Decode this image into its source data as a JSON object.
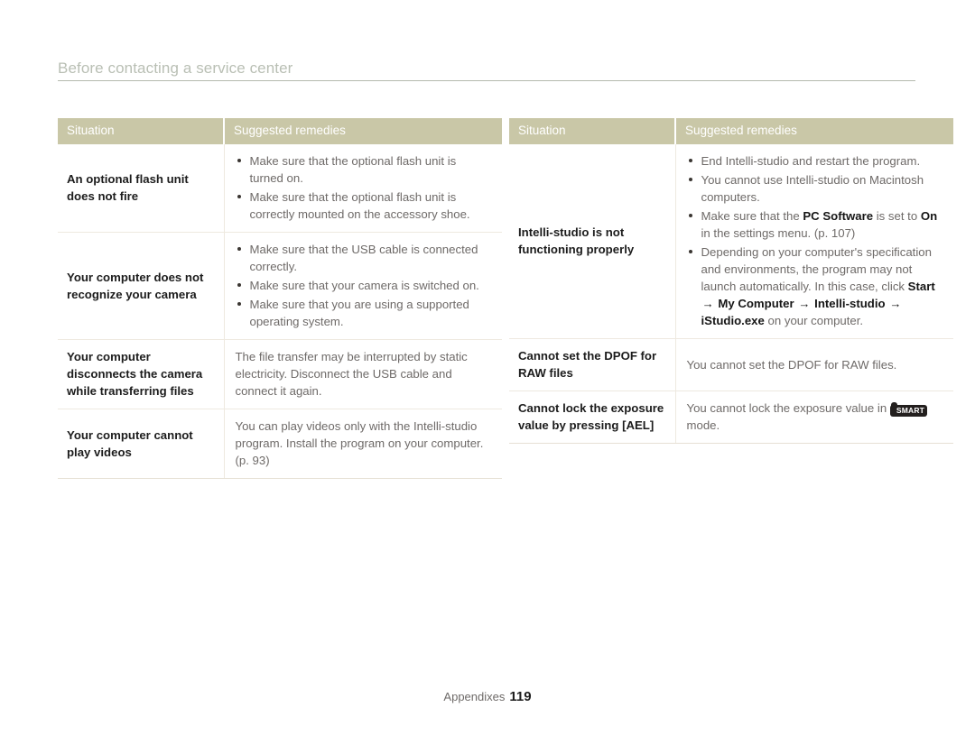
{
  "header": {
    "title": "Before contacting a service center"
  },
  "colors": {
    "table_header_bg": "#c9c7a7",
    "title_text": "#b9bfb4",
    "body_text": "#6e6a68",
    "situation_text": "#1c1c1c",
    "row_divider": "#eee9e0"
  },
  "tables": [
    {
      "id": "left",
      "columns": [
        "Situation",
        "Suggested remedies"
      ],
      "rows": [
        {
          "situation": "An optional flash unit does not fire",
          "remedies": [
            "Make sure that the optional flash unit is turned on.",
            "Make sure that the optional flash unit is correctly mounted on the accessory shoe."
          ]
        },
        {
          "situation": "Your computer does not recognize your camera",
          "remedies": [
            "Make sure that the USB cable is connected correctly.",
            "Make sure that your camera is switched on.",
            "Make sure that you are using a supported operating system."
          ]
        },
        {
          "situation": "Your computer disconnects the camera while transferring files",
          "paragraph": "The file transfer may be interrupted by static electricity. Disconnect the USB cable and connect it again."
        },
        {
          "situation": "Your computer cannot play videos",
          "paragraph": "You can play videos only with the Intelli-studio program. Install the program on your computer. (p. 93)"
        }
      ]
    },
    {
      "id": "right",
      "columns": [
        "Situation",
        "Suggested remedies"
      ],
      "rows": [
        {
          "situation": "Intelli-studio is not functioning properly",
          "remedies_rich": [
            "End Intelli-studio and restart the program.",
            "You cannot use Intelli-studio on Macintosh computers.",
            "Make sure that the <b>PC Software</b> is set to <b>On</b> in the settings menu. (p. 107)",
            "Depending on your computer's specification and environments, the program may not launch automatically. In this case, click <b>Start</b> <span class=\"arrow\">&#8594;</span> <b>My Computer</b> <span class=\"arrow\">&#8594;</span> <b>Intelli-studio</b> <span class=\"arrow\">&#8594;</span> <b>iStudio.exe</b> on your computer."
          ]
        },
        {
          "situation": "Cannot set the DPOF for RAW files",
          "paragraph": "You cannot set the DPOF for RAW files."
        },
        {
          "situation_rich": "Cannot lock the exposure value by pressing [<span class=\"k\">AEL</span>]",
          "paragraph_rich": "You cannot lock the exposure value in <span class=\"smart-badge\" data-name=\"smart-mode-badge\">SMART</span> mode."
        }
      ]
    }
  ],
  "footer": {
    "label": "Appendixes",
    "page_number": "119"
  }
}
